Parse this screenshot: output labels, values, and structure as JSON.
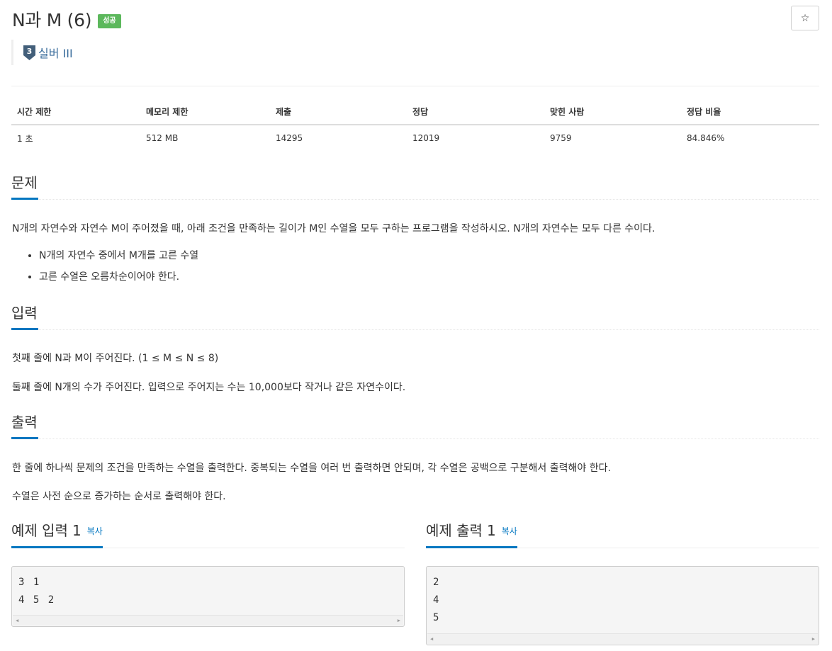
{
  "problem": {
    "title": "N과 M (6)",
    "status_badge": "성공",
    "star_label": "☆",
    "tier_level": "3",
    "tier_label": "실버 III"
  },
  "info_table": {
    "headers": [
      "시간 제한",
      "메모리 제한",
      "제출",
      "정답",
      "맞힌 사람",
      "정답 비율"
    ],
    "values": [
      "1 초",
      "512 MB",
      "14295",
      "12019",
      "9759",
      "84.846%"
    ]
  },
  "sections": {
    "description": {
      "heading": "문제",
      "text": "N개의 자연수와 자연수 M이 주어졌을 때, 아래 조건을 만족하는 길이가 M인 수열을 모두 구하는 프로그램을 작성하시오. N개의 자연수는 모두 다른 수이다.",
      "bullets": [
        "N개의 자연수 중에서 M개를 고른 수열",
        "고른 수열은 오름차순이어야 한다."
      ]
    },
    "input": {
      "heading": "입력",
      "lines": [
        "첫째 줄에 N과 M이 주어진다. (1 ≤ M ≤ N ≤ 8)",
        "둘째 줄에 N개의 수가 주어진다. 입력으로 주어지는 수는 10,000보다 작거나 같은 자연수이다."
      ]
    },
    "output": {
      "heading": "출력",
      "lines": [
        "한 줄에 하나씩 문제의 조건을 만족하는 수열을 출력한다. 중복되는 수열을 여러 번 출력하면 안되며, 각 수열은 공백으로 구분해서 출력해야 한다.",
        "수열은 사전 순으로 증가하는 순서로 출력해야 한다."
      ]
    }
  },
  "samples": {
    "input": {
      "label": "예제 입력",
      "number": "1",
      "copy": "복사",
      "lines": [
        "3 1",
        "4 5 2"
      ]
    },
    "output": {
      "label": "예제 출력",
      "number": "1",
      "copy": "복사",
      "lines": [
        "2",
        "4",
        "5"
      ]
    }
  },
  "scrollbar": {
    "left_arrow": "◀",
    "right_arrow": "▶"
  },
  "colors": {
    "accent": "#0076c0",
    "success": "#5cb85c",
    "tier_silver": "#435f7a"
  }
}
